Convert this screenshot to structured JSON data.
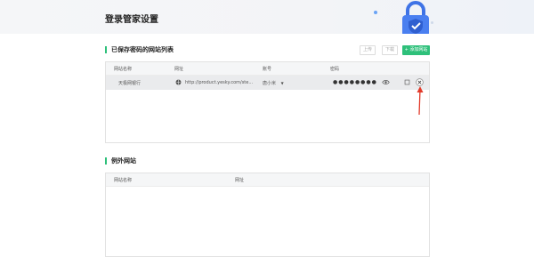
{
  "header": {
    "title": "登录管家设置"
  },
  "saved_sites": {
    "title": "已保存密码的网站列表",
    "buttons": {
      "upload": "上传",
      "download": "下载",
      "add": "添加网站"
    },
    "columns": [
      "网站名称",
      "网址",
      "账号",
      "密码"
    ],
    "rows": [
      {
        "name": "天极网银行",
        "url": "http://product.yesky.com/ste...",
        "account": "唐小米",
        "password": "●●●●●●●●"
      }
    ]
  },
  "excluded_sites": {
    "title": "例外网站",
    "columns": [
      "网站名称",
      "网址"
    ]
  },
  "colors": {
    "accent": "#2ec07a",
    "header_bg": "#f5f6f8",
    "row_hover": "#eaebed",
    "arrow": "#e23a2a"
  }
}
